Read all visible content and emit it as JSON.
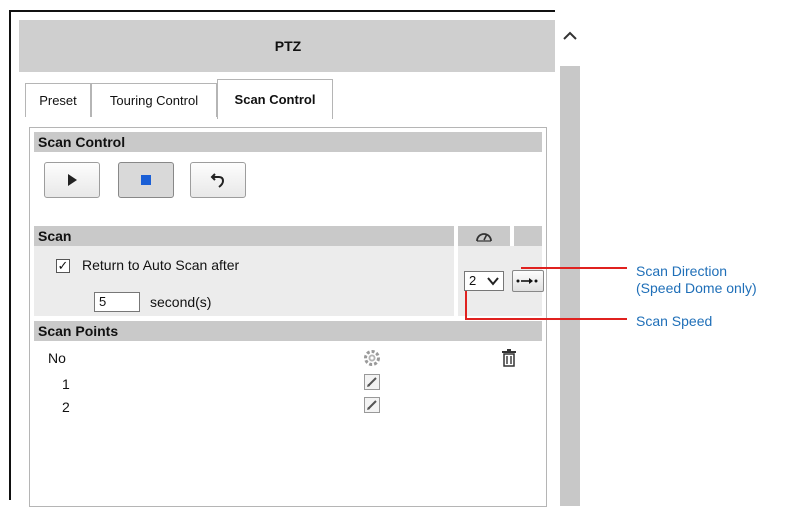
{
  "panel": {
    "title": "PTZ"
  },
  "tabs": [
    {
      "label": "Preset",
      "active": false
    },
    {
      "label": "Touring Control",
      "active": false
    },
    {
      "label": "Scan Control",
      "active": true
    }
  ],
  "scan_control": {
    "section_title": "Scan Control",
    "buttons": [
      {
        "icon": "play-icon"
      },
      {
        "icon": "stop-icon",
        "pressed": true
      },
      {
        "icon": "return-icon"
      }
    ]
  },
  "scan": {
    "section_title": "Scan",
    "speed_icon": "speedometer-icon",
    "checkbox_checked": true,
    "checkbox_mark": "✓",
    "auto_scan_label": "Return to Auto Scan after",
    "seconds_value": "5",
    "seconds_unit": "second(s)",
    "speed_value": "2",
    "direction_icon": "scan-direction-icon"
  },
  "scan_points": {
    "section_title": "Scan Points",
    "col_no": "No",
    "settings_icon": "gear-icon",
    "delete_icon": "trash-icon",
    "rows": [
      {
        "no": "1",
        "icon": "edit-icon"
      },
      {
        "no": "2",
        "icon": "edit-icon"
      }
    ]
  },
  "callouts": {
    "direction_line1": "Scan Direction",
    "direction_line2": "(Speed Dome only)",
    "speed": "Scan Speed"
  },
  "colors": {
    "callout_text": "#1f6fb8",
    "callout_line": "#e0211f",
    "header_bg": "#cfcfcf",
    "section_bg": "#c9c9c9",
    "stop_blue": "#1a5fd6"
  }
}
